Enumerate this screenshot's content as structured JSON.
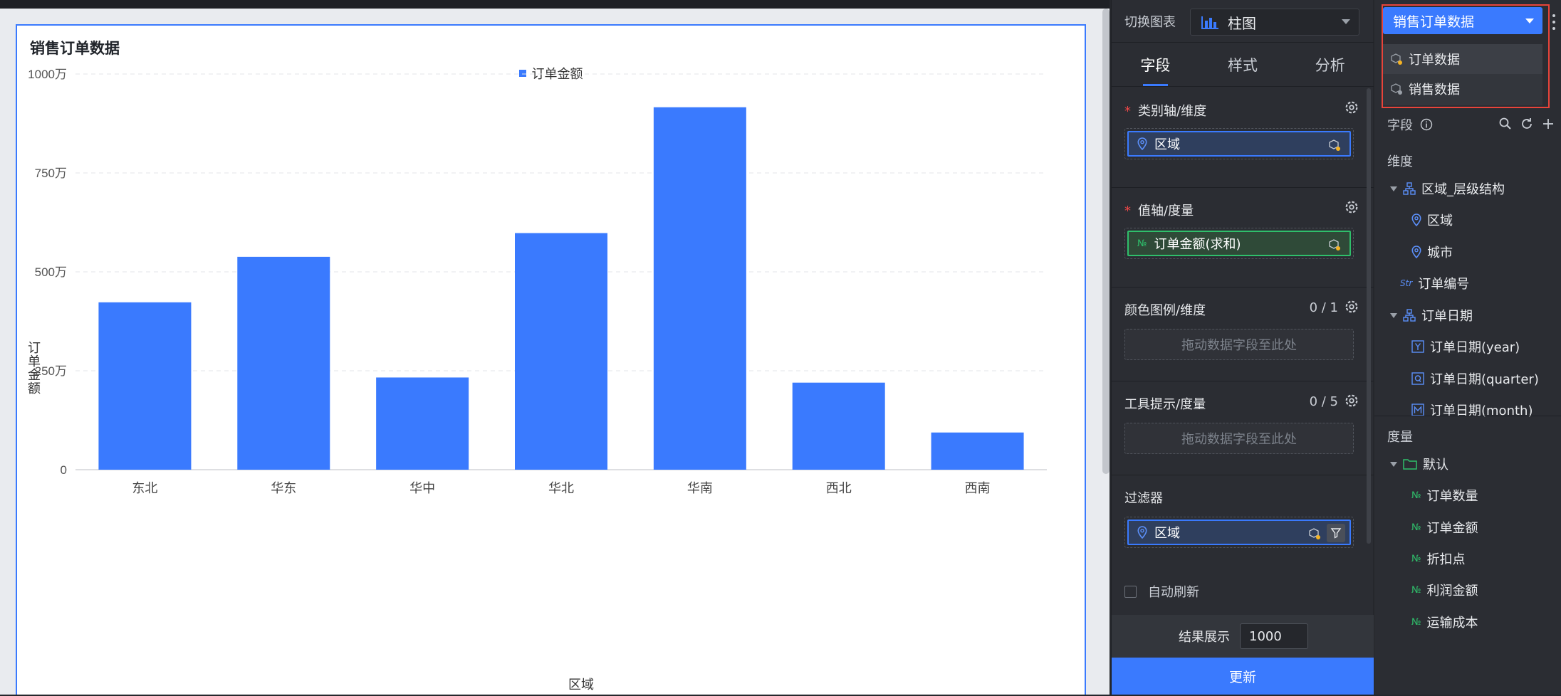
{
  "chart": {
    "title": "销售订单数据"
  },
  "chart_data": {
    "type": "bar",
    "title": "销售订单数据",
    "xlabel": "区域",
    "ylabel": "订单金额",
    "legend": [
      "订单金额"
    ],
    "legend_position": "top",
    "categories": [
      "东北",
      "华东",
      "华中",
      "华北",
      "华南",
      "西北",
      "西南"
    ],
    "series": [
      {
        "name": "订单金额",
        "values": [
          4230000,
          5380000,
          2330000,
          5980000,
          9160000,
          2200000,
          940000
        ]
      }
    ],
    "ylim": [
      0,
      10000000
    ],
    "yticks": [
      0,
      2500000,
      5000000,
      7500000,
      10000000
    ],
    "ytick_labels": [
      "0",
      "250万",
      "500万",
      "750万",
      "1000万"
    ],
    "grid": "horizontal dashed",
    "bar_color": "#3a7afe"
  },
  "config": {
    "switch_label": "切换图表",
    "chart_type": "柱图",
    "tabs": [
      "字段",
      "样式",
      "分析"
    ],
    "sections": {
      "category_axis": {
        "title": "类别轴/维度",
        "field": "区域"
      },
      "value_axis": {
        "title": "值轴/度量",
        "field": "订单金额(求和)"
      },
      "color_legend": {
        "title": "颜色图例/维度",
        "count": "0 / 1",
        "placeholder": "拖动数据字段至此处"
      },
      "tooltip": {
        "title": "工具提示/度量",
        "count": "0 / 5",
        "placeholder": "拖动数据字段至此处"
      },
      "filter": {
        "title": "过滤器",
        "field": "区域"
      }
    },
    "auto_refresh": "自动刷新",
    "result_label": "结果展示",
    "result_value": "1000",
    "update_button": "更新"
  },
  "data_panel": {
    "dataset_selected": "销售订单数据",
    "dataset_options": [
      "订单数据",
      "销售数据"
    ],
    "fields_label": "字段",
    "dimension_label": "维度",
    "dimensions": [
      {
        "label": "区域_层级结构",
        "icon": "hierarchy-icon",
        "level": 0
      },
      {
        "label": "区域",
        "icon": "location-icon",
        "level": 1
      },
      {
        "label": "城市",
        "icon": "location-icon",
        "level": 1
      },
      {
        "label": "订单编号",
        "icon": "string-icon",
        "level": 0
      },
      {
        "label": "订单日期",
        "icon": "hierarchy-icon",
        "level": 0
      },
      {
        "label": "订单日期(year)",
        "icon": "year-icon",
        "level": 1
      },
      {
        "label": "订单日期(quarter)",
        "icon": "quarter-icon",
        "level": 1
      },
      {
        "label": "订单日期(month)",
        "icon": "month-icon",
        "level": 1
      }
    ],
    "measure_label": "度量",
    "measure_folder": "默认",
    "measures": [
      "订单数量",
      "订单金额",
      "折扣点",
      "利润金额",
      "运输成本"
    ]
  },
  "colors": {
    "accent": "#3a7afe",
    "measure": "#2fbf6b",
    "highlight": "#e8443a"
  }
}
